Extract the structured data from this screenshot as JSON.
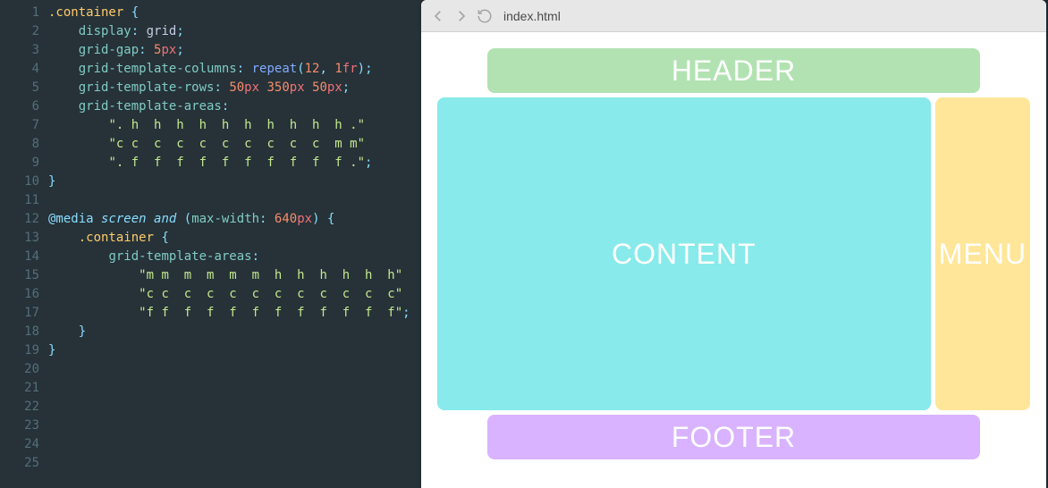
{
  "editor": {
    "line_count": 25,
    "lines": [
      {
        "n": 1,
        "html": "<span class='tok-selector'>.container</span> <span class='tok-punct'>{</span>"
      },
      {
        "n": 2,
        "html": "    <span class='tok-prop'>display</span><span class='tok-punct'>:</span> <span class='tok-value'>grid</span><span class='tok-punct'>;</span>"
      },
      {
        "n": 3,
        "html": "    <span class='tok-prop'>grid-gap</span><span class='tok-punct'>:</span> <span class='tok-num'>5</span><span class='tok-unit'>px</span><span class='tok-punct'>;</span>"
      },
      {
        "n": 4,
        "html": "    <span class='tok-prop'>grid-template-columns</span><span class='tok-punct'>:</span> <span class='tok-func'>repeat</span><span class='tok-punct'>(</span><span class='tok-num'>12</span><span class='tok-punct'>,</span> <span class='tok-num'>1</span><span class='tok-unit'>fr</span><span class='tok-punct'>);</span>"
      },
      {
        "n": 5,
        "html": "    <span class='tok-prop'>grid-template-rows</span><span class='tok-punct'>:</span> <span class='tok-num'>50</span><span class='tok-unit'>px</span> <span class='tok-num'>350</span><span class='tok-unit'>px</span> <span class='tok-num'>50</span><span class='tok-unit'>px</span><span class='tok-punct'>;</span>"
      },
      {
        "n": 6,
        "html": "    <span class='tok-prop'>grid-template-areas</span><span class='tok-punct'>:</span>"
      },
      {
        "n": 7,
        "html": "        <span class='tok-string'>\". h  h  h  h  h  h  h  h  h  h .\"</span>"
      },
      {
        "n": 8,
        "html": "        <span class='tok-string'>\"c c  c  c  c  c  c  c  c  c  m m\"</span>"
      },
      {
        "n": 9,
        "html": "        <span class='tok-string'>\". f  f  f  f  f  f  f  f  f  f .\"</span><span class='tok-punct'>;</span>"
      },
      {
        "n": 10,
        "html": "<span class='tok-punct'>}</span>"
      },
      {
        "n": 11,
        "html": ""
      },
      {
        "n": 12,
        "html": "<span class='tok-at'>@media</span> <span class='tok-kw'>screen and</span> <span class='tok-punct'>(</span><span class='tok-prop'>max-width</span><span class='tok-punct'>:</span> <span class='tok-num'>640</span><span class='tok-unit'>px</span><span class='tok-punct'>)</span> <span class='tok-punct'>{</span>"
      },
      {
        "n": 13,
        "html": "    <span class='tok-selector'>.container</span> <span class='tok-punct'>{</span>"
      },
      {
        "n": 14,
        "html": "        <span class='tok-prop'>grid-template-areas</span><span class='tok-punct'>:</span>"
      },
      {
        "n": 15,
        "html": "            <span class='tok-string'>\"m m  m  m  m  m  h  h  h  h  h  h\"</span>"
      },
      {
        "n": 16,
        "html": "            <span class='tok-string'>\"c c  c  c  c  c  c  c  c  c  c  c\"</span>"
      },
      {
        "n": 17,
        "html": "            <span class='tok-string'>\"f f  f  f  f  f  f  f  f  f  f  f\"</span><span class='tok-punct'>;</span>"
      },
      {
        "n": 18,
        "html": "    <span class='tok-punct'>}</span>"
      },
      {
        "n": 19,
        "html": "<span class='tok-punct'>}</span>"
      },
      {
        "n": 20,
        "html": ""
      },
      {
        "n": 21,
        "html": ""
      },
      {
        "n": 22,
        "html": ""
      },
      {
        "n": 23,
        "html": ""
      },
      {
        "n": 24,
        "html": ""
      },
      {
        "n": 25,
        "html": ""
      }
    ]
  },
  "browser": {
    "url": "index.html"
  },
  "layout": {
    "header": "HEADER",
    "content": "CONTENT",
    "menu": "MENU",
    "footer": "FOOTER"
  }
}
